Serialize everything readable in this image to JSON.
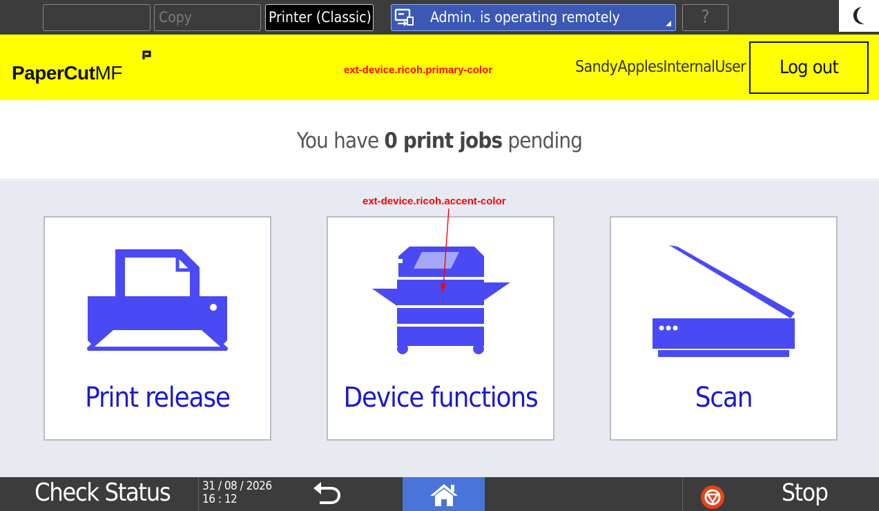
{
  "topbar": {
    "copy_label": "Copy",
    "printer_label": "Printer (Classic)",
    "remote_label": "Admin. is operating remotely",
    "help_label": "?"
  },
  "header": {
    "brand_main": "PaperCut",
    "brand_suffix": "MF",
    "primary_color_note": "ext-device.ricoh.primary-color",
    "username": "SandyApplesInternalUser",
    "logout_label": "Log out"
  },
  "pending": {
    "prefix": "You have ",
    "count_text": "0 print jobs",
    "suffix": " pending"
  },
  "main": {
    "accent_color_note": "ext-device.ricoh.accent-color",
    "tiles": [
      {
        "label": "Print release"
      },
      {
        "label": "Device functions"
      },
      {
        "label": "Scan"
      }
    ]
  },
  "bottombar": {
    "check_status_label": "Check Status",
    "date": "31 / 08 / 2026",
    "time": "16 : 12",
    "stop_label": "Stop"
  },
  "colors": {
    "primary": "#ffff00",
    "accent": "#4a4af5",
    "label": "#1a1acc",
    "annotation": "#ff0000",
    "home_active": "#4a74d8"
  }
}
